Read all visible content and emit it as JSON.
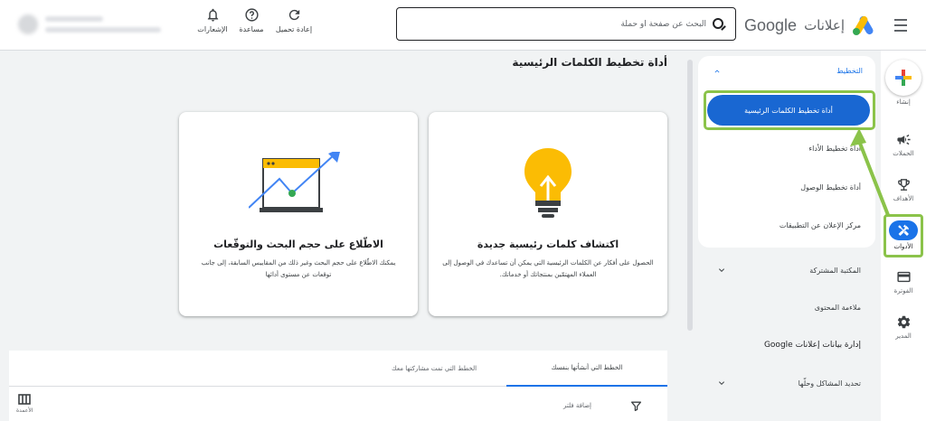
{
  "header": {
    "product_name": "إعلانات",
    "brand_word": "Google",
    "search_placeholder": "البحث عن صفحة أو حملة",
    "actions": [
      {
        "id": "refresh",
        "label": "إعادة تحميل",
        "icon": "refresh-icon"
      },
      {
        "id": "help",
        "label": "مساعدة",
        "icon": "help-icon"
      },
      {
        "id": "notifications",
        "label": "الإشعارات",
        "icon": "bell-icon"
      }
    ]
  },
  "rail": {
    "items": [
      {
        "id": "create",
        "label": "إنشاء",
        "icon": "plus-icon"
      },
      {
        "id": "campaigns",
        "label": "الحملات",
        "icon": "megaphone-icon"
      },
      {
        "id": "goals",
        "label": "الأهداف",
        "icon": "trophy-icon"
      },
      {
        "id": "tools",
        "label": "الأدوات",
        "icon": "tools-icon",
        "active": true
      },
      {
        "id": "billing",
        "label": "الفوترة",
        "icon": "credit-card-icon"
      },
      {
        "id": "admin",
        "label": "المدير",
        "icon": "gear-icon"
      }
    ]
  },
  "nav": {
    "section_title": "التخطيط",
    "planning_items": [
      {
        "label": "أداة تخطيط الكلمات الرئيسية",
        "selected": true
      },
      {
        "label": "أداة تخطيط الأداء"
      },
      {
        "label": "أداة تخطيط الوصول"
      },
      {
        "label": "مركز الإعلان عن التطبيقات"
      }
    ],
    "rows": [
      {
        "label": "المكتبة المشتركة",
        "expandable": true
      },
      {
        "label": "ملاءمة المحتوى",
        "expandable": false
      },
      {
        "label": "إدارة بيانات إعلانات Google",
        "expandable": false,
        "bold": true
      },
      {
        "label": "تحديد المشاكل وحلّها",
        "expandable": true
      }
    ]
  },
  "main": {
    "page_title": "أداة تخطيط الكلمات الرئيسية",
    "cards": [
      {
        "id": "discover",
        "title": "اكتشاف كلمات رئيسية جديدة",
        "description": "الحصول على أفكار عن الكلمات الرئيسية التي يمكن أن تساعدك في الوصول إلى العملاء المهتمّين بمنتجاتك أو خدماتك."
      },
      {
        "id": "forecast",
        "title": "الاطّلاع على حجم البحث والتوقّعات",
        "description": "يمكنك الاطّلاع على حجم البحث وغير ذلك من المقاييس السابقة، إلى جانب توقعات عن مستوى أدائها"
      }
    ],
    "tabs": [
      {
        "label": "الخطط التي أنشأتها بنفسك",
        "active": true
      },
      {
        "label": "الخطط التي تمت مشاركتها معك",
        "active": false
      }
    ],
    "filter_label": "إضافة فلتر",
    "columns_label": "الأعمدة"
  },
  "colors": {
    "accent": "#1a73e8",
    "highlight": "#8bc34a",
    "bulb": "#fbbc04"
  }
}
